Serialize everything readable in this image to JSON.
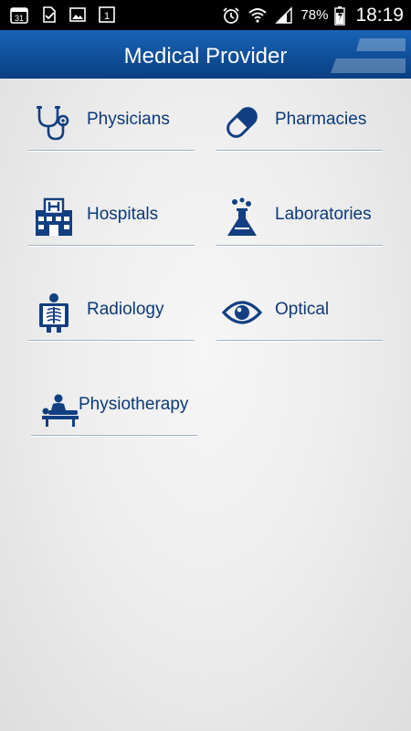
{
  "status_bar": {
    "calendar_badge": "31",
    "notification_badge": "1",
    "battery_percent": "78%",
    "time": "18:19",
    "icons": [
      "calendar-icon",
      "download-done-icon",
      "gallery-icon",
      "notification-count-icon",
      "alarm-icon",
      "wifi-icon",
      "signal-icon",
      "battery-charging-icon"
    ]
  },
  "header": {
    "title": "Medical Provider",
    "background_color": "#0f4f99",
    "logo_icon": "brand-logo-icon"
  },
  "menu": {
    "items": [
      {
        "label": "Physicians",
        "icon": "stethoscope-icon"
      },
      {
        "label": "Pharmacies",
        "icon": "pill-capsule-icon"
      },
      {
        "label": "Hospitals",
        "icon": "hospital-building-icon"
      },
      {
        "label": "Laboratories",
        "icon": "lab-flask-icon"
      },
      {
        "label": "Radiology",
        "icon": "xray-icon"
      },
      {
        "label": "Optical",
        "icon": "eye-icon"
      },
      {
        "label": "Physiotherapy",
        "icon": "massage-table-icon"
      }
    ]
  },
  "colors": {
    "label_color": "#0c3a78",
    "divider_color": "#9fb2c6",
    "icon_color": "#123f82"
  }
}
